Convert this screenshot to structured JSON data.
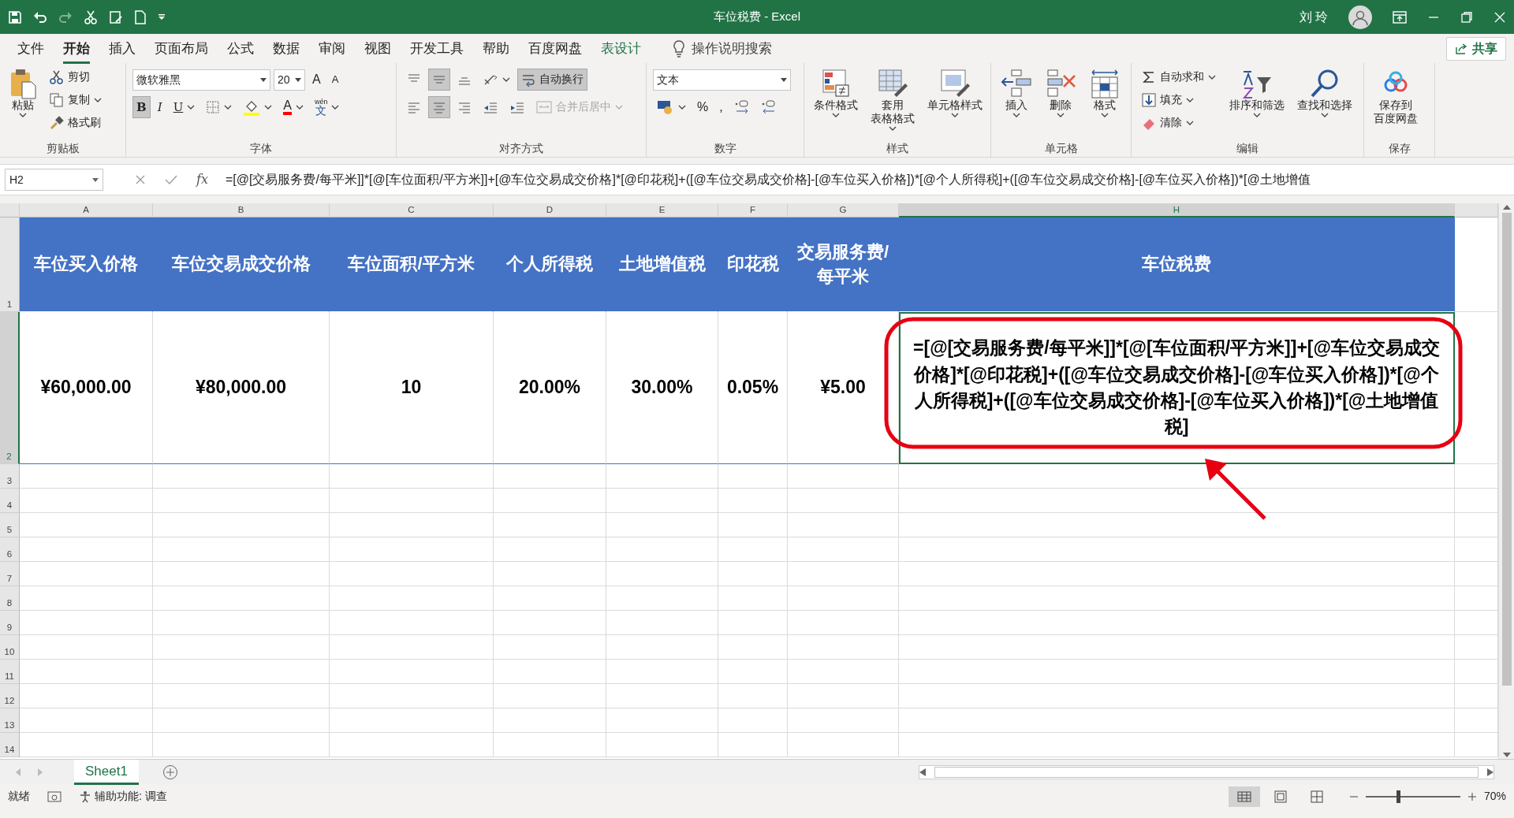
{
  "window": {
    "title": "车位税费  -  Excel",
    "user": "刘 玲"
  },
  "menu": {
    "tabs": [
      {
        "label": "文件",
        "selected": false,
        "kind": "normal"
      },
      {
        "label": "开始",
        "selected": true,
        "kind": "normal"
      },
      {
        "label": "插入",
        "selected": false,
        "kind": "normal"
      },
      {
        "label": "页面布局",
        "selected": false,
        "kind": "normal"
      },
      {
        "label": "公式",
        "selected": false,
        "kind": "normal"
      },
      {
        "label": "数据",
        "selected": false,
        "kind": "normal"
      },
      {
        "label": "审阅",
        "selected": false,
        "kind": "normal"
      },
      {
        "label": "视图",
        "selected": false,
        "kind": "normal"
      },
      {
        "label": "开发工具",
        "selected": false,
        "kind": "normal"
      },
      {
        "label": "帮助",
        "selected": false,
        "kind": "normal"
      },
      {
        "label": "百度网盘",
        "selected": false,
        "kind": "normal"
      },
      {
        "label": "表设计",
        "selected": false,
        "kind": "contextual"
      }
    ],
    "search": "操作说明搜索",
    "share": "共享"
  },
  "ribbon": {
    "groups": [
      {
        "label": "剪贴板",
        "kind": "clipboard",
        "items": [
          {
            "kind": "paste",
            "label": "粘贴"
          },
          {
            "kind": "cut",
            "label": "剪切"
          },
          {
            "kind": "copy",
            "label": "复制"
          },
          {
            "kind": "painter",
            "label": "格式刷"
          }
        ]
      },
      {
        "label": "字体",
        "kind": "font",
        "items": [
          {
            "kind": "fontname",
            "value": "微软雅黑"
          },
          {
            "kind": "fontsize",
            "value": "20"
          },
          {
            "kind": "grow",
            "label": "A"
          },
          {
            "kind": "shrink",
            "label": "A"
          },
          {
            "kind": "bold",
            "label": "B",
            "on": true
          },
          {
            "kind": "italic",
            "label": "I",
            "on": false
          },
          {
            "kind": "underline",
            "label": "U",
            "on": false
          },
          {
            "kind": "borders"
          },
          {
            "kind": "fillcolor"
          },
          {
            "kind": "fontcolor",
            "label": "A"
          },
          {
            "kind": "phonetic",
            "ruby": "wén",
            "label": "文"
          }
        ]
      },
      {
        "label": "对齐方式",
        "kind": "alignment",
        "items": [
          {
            "kind": "aligntop",
            "on": false
          },
          {
            "kind": "alignmiddle",
            "on": true
          },
          {
            "kind": "alignbottom",
            "on": false
          },
          {
            "kind": "orient"
          },
          {
            "kind": "wrap",
            "label": "自动换行",
            "on": true
          },
          {
            "kind": "alignleft",
            "on": false
          },
          {
            "kind": "aligncenter",
            "on": true
          },
          {
            "kind": "alignright",
            "on": false
          },
          {
            "kind": "outdent"
          },
          {
            "kind": "indent"
          },
          {
            "kind": "merge",
            "label": "合并后居中",
            "disabled": true
          }
        ]
      },
      {
        "label": "数字",
        "kind": "number",
        "items": [
          {
            "kind": "numformat",
            "value": "文本"
          },
          {
            "kind": "accounting"
          },
          {
            "kind": "percent",
            "label": "%"
          },
          {
            "kind": "comma",
            "label": ","
          },
          {
            "kind": "incdec"
          },
          {
            "kind": "decdec"
          }
        ]
      },
      {
        "label": "样式",
        "kind": "styles",
        "items": [
          {
            "kind": "condfmt",
            "label": "条件格式"
          },
          {
            "kind": "tablefmt",
            "lines": [
              "套用",
              "表格格式"
            ]
          },
          {
            "kind": "cellstyle",
            "label": "单元格样式"
          }
        ]
      },
      {
        "label": "单元格",
        "kind": "cells",
        "items": [
          {
            "kind": "insert",
            "label": "插入"
          },
          {
            "kind": "delete",
            "label": "删除"
          },
          {
            "kind": "format",
            "label": "格式"
          }
        ]
      },
      {
        "label": "编辑",
        "kind": "editing",
        "items": [
          {
            "kind": "autosum",
            "label": "自动求和"
          },
          {
            "kind": "fill",
            "label": "填充"
          },
          {
            "kind": "clear",
            "label": "清除"
          },
          {
            "kind": "sort",
            "label": "排序和筛选"
          },
          {
            "kind": "find",
            "label": "查找和选择"
          }
        ]
      },
      {
        "label": "保存",
        "kind": "save",
        "items": [
          {
            "kind": "baidu",
            "lines": [
              "保存到",
              "百度网盘"
            ]
          }
        ]
      }
    ]
  },
  "formula_bar": {
    "name_box": "H2",
    "fx": "fx",
    "formula": "=[@[交易服务费/每平米]]*[@[车位面积/平方米]]+[@车位交易成交价格]*[@印花税]+([@车位交易成交价格]-[@车位买入价格])*[@个人所得税]+([@车位交易成交价格]-[@车位买入价格])*[@土地增值"
  },
  "sheet": {
    "columns": [
      {
        "label": "A",
        "selected": false
      },
      {
        "label": "B",
        "selected": false
      },
      {
        "label": "C",
        "selected": false
      },
      {
        "label": "D",
        "selected": false
      },
      {
        "label": "E",
        "selected": false
      },
      {
        "label": "F",
        "selected": false
      },
      {
        "label": "G",
        "selected": false
      },
      {
        "label": "H",
        "selected": true
      }
    ],
    "rows": [
      {
        "label": "1",
        "selected": false
      },
      {
        "label": "2",
        "selected": true
      },
      {
        "label": "3",
        "selected": false
      },
      {
        "label": "4",
        "selected": false
      },
      {
        "label": "5",
        "selected": false
      },
      {
        "label": "6",
        "selected": false
      },
      {
        "label": "7",
        "selected": false
      },
      {
        "label": "8",
        "selected": false
      },
      {
        "label": "9",
        "selected": false
      },
      {
        "label": "10",
        "selected": false
      },
      {
        "label": "11",
        "selected": false
      },
      {
        "label": "12",
        "selected": false
      },
      {
        "label": "13",
        "selected": false
      },
      {
        "label": "14",
        "selected": false
      }
    ],
    "table": {
      "header": [
        "车位买入价格",
        "车位交易成交价格",
        "车位面积/平方米",
        "个人所得税",
        "土地增值税",
        "印花税",
        "交易服务费/每平米",
        "车位税费"
      ],
      "rows": [
        [
          "¥60,000.00",
          "¥80,000.00",
          "10",
          "20.00%",
          "30.00%",
          "0.05%",
          "¥5.00",
          "=[@[交易服务费/每平米]]*[@[车位面积/平方米]]+[@车位交易成交价格]*[@印花税]+([@车位交易成交价格]-[@车位买入价格])*[@个人所得税]+([@车位交易成交价格]-[@车位买入价格])*[@土地增值税]"
        ]
      ]
    }
  },
  "sheet_tabs": [
    {
      "label": "Sheet1",
      "selected": true
    }
  ],
  "status_bar": {
    "status": "就绪",
    "accessibility": "辅助功能: 调查",
    "views": [
      {
        "kind": "normal",
        "selected": true
      },
      {
        "kind": "layout",
        "selected": false
      },
      {
        "kind": "pagebreak",
        "selected": false
      }
    ],
    "zoom": {
      "level": 0.34,
      "reading": "70%"
    }
  }
}
